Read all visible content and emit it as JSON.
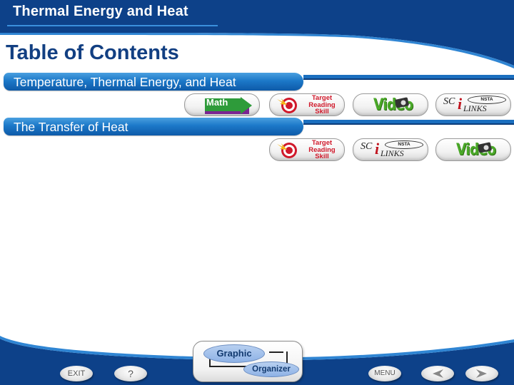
{
  "header": {
    "title": "Thermal Energy and Heat"
  },
  "page_title": "Table of Contents",
  "colors": {
    "brand_blue": "#0d4189",
    "accent_blue": "#1b6fbf",
    "title_blue": "#123f82"
  },
  "sections": [
    {
      "label": "Temperature, Thermal Energy, and Heat",
      "resources": [
        {
          "type": "math",
          "label": "Math"
        },
        {
          "type": "target-reading-skill",
          "label": "Target Reading Skill",
          "lines": [
            "Target",
            "Reading",
            "Skill"
          ]
        },
        {
          "type": "video",
          "label": "Video"
        },
        {
          "type": "scilinks",
          "label": "SciLinks",
          "sc": "SC",
          "i": "i",
          "links": "LINKS",
          "nsta": "NSTA"
        }
      ]
    },
    {
      "label": "The Transfer of Heat",
      "resources": [
        {
          "type": "target-reading-skill",
          "label": "Target Reading Skill",
          "lines": [
            "Target",
            "Reading",
            "Skill"
          ]
        },
        {
          "type": "scilinks",
          "label": "SciLinks",
          "sc": "SC",
          "i": "i",
          "links": "LINKS",
          "nsta": "NSTA"
        },
        {
          "type": "video",
          "label": "Video"
        }
      ]
    }
  ],
  "footer": {
    "exit_label": "EXIT",
    "help_label": "?",
    "graphic_organizer": {
      "line1": "Graphic",
      "line2": "Organizer"
    },
    "menu_label": "MENU",
    "prev_icon": "left-arrow-icon",
    "next_icon": "right-arrow-icon"
  }
}
